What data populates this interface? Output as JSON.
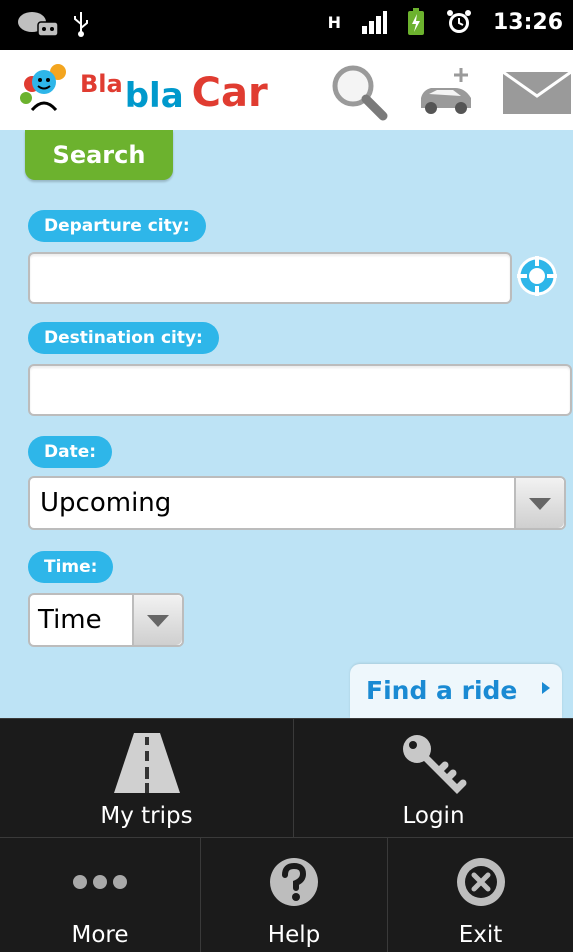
{
  "status_bar": {
    "time": "13:26",
    "network_label": "H"
  },
  "header": {
    "logo": {
      "part1": "Bla",
      "part2": "bla",
      "part3": "Car"
    }
  },
  "search": {
    "tab_label": "Search",
    "departure_label": "Departure city:",
    "departure_value": "",
    "destination_label": "Destination city:",
    "destination_value": "",
    "date_label": "Date:",
    "date_value": "Upcoming",
    "time_label": "Time:",
    "time_value": "Time",
    "find_button_label": "Find a ride"
  },
  "menu": {
    "items": [
      {
        "label": "My trips",
        "icon": "road-icon"
      },
      {
        "label": "Login",
        "icon": "key-icon"
      },
      {
        "label": "More",
        "icon": "more-icon"
      },
      {
        "label": "Help",
        "icon": "help-icon"
      },
      {
        "label": "Exit",
        "icon": "exit-icon"
      }
    ]
  },
  "colors": {
    "background": "#bde3f5",
    "search_tab": "#6cb22e",
    "label_pill": "#2eb6e9",
    "brand_red": "#e03c31",
    "brand_blue": "#0099cc",
    "link_blue": "#1a8ad3"
  }
}
